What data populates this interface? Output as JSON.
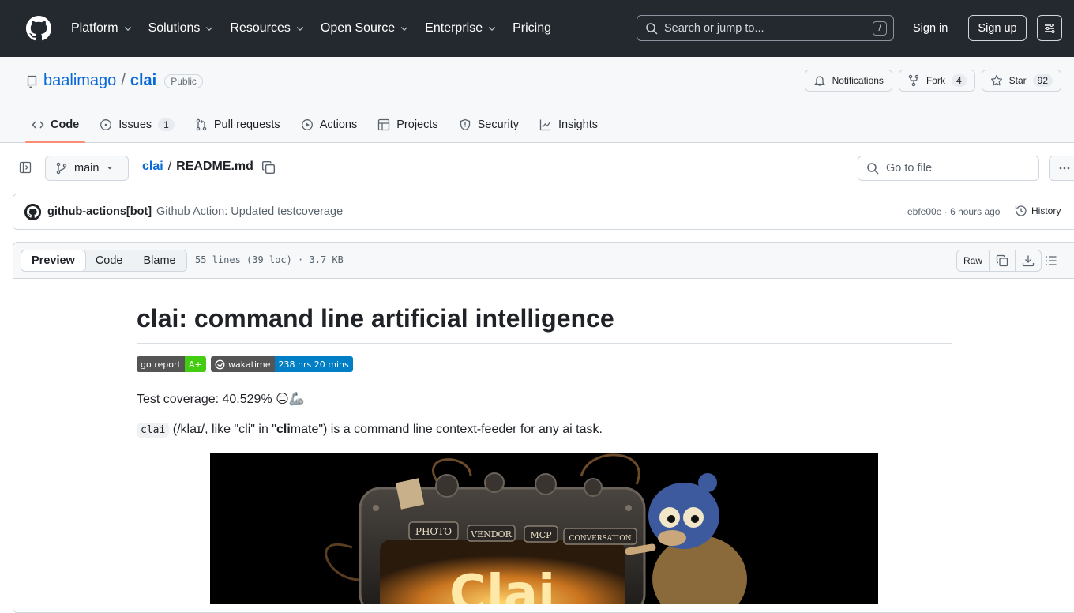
{
  "header": {
    "nav": [
      {
        "label": "Platform",
        "dropdown": true
      },
      {
        "label": "Solutions",
        "dropdown": true
      },
      {
        "label": "Resources",
        "dropdown": true
      },
      {
        "label": "Open Source",
        "dropdown": true
      },
      {
        "label": "Enterprise",
        "dropdown": true
      },
      {
        "label": "Pricing",
        "dropdown": false
      }
    ],
    "search_placeholder": "Search or jump to...",
    "search_shortcut": "/",
    "sign_in": "Sign in",
    "sign_up": "Sign up"
  },
  "repo": {
    "owner": "baalimago",
    "separator": "/",
    "name": "clai",
    "visibility": "Public",
    "notifications_label": "Notifications",
    "fork_label": "Fork",
    "fork_count": "4",
    "star_label": "Star",
    "star_count": "92"
  },
  "tabs": [
    {
      "label": "Code",
      "icon": "code-icon",
      "active": true
    },
    {
      "label": "Issues",
      "icon": "issue-opened-icon",
      "count": "1"
    },
    {
      "label": "Pull requests",
      "icon": "git-pull-request-icon"
    },
    {
      "label": "Actions",
      "icon": "play-icon"
    },
    {
      "label": "Projects",
      "icon": "table-icon"
    },
    {
      "label": "Security",
      "icon": "shield-icon"
    },
    {
      "label": "Insights",
      "icon": "graph-icon"
    }
  ],
  "file_nav": {
    "branch": "main",
    "repo_link": "clai",
    "separator": "/",
    "file_name": "README.md",
    "goto_placeholder": "Go to file"
  },
  "commit": {
    "author": "github-actions[bot]",
    "message": "Github Action: Updated testcoverage",
    "sha": "ebfe00e",
    "dot": "·",
    "time": "6 hours ago",
    "history_label": "History"
  },
  "file_toolbar": {
    "views": [
      {
        "label": "Preview",
        "active": true
      },
      {
        "label": "Code",
        "active": false
      },
      {
        "label": "Blame",
        "active": false
      }
    ],
    "info": "55 lines (39 loc) · 3.7 KB",
    "raw_label": "Raw"
  },
  "readme": {
    "title": "clai: command line artificial intelligence",
    "badges": {
      "go_report_label": "go report",
      "go_report_value": "A+",
      "go_report_color": "#44cc11",
      "wakatime_label": "wakatime",
      "wakatime_value": "238 hrs 20 mins",
      "wakatime_color": "#007ec6"
    },
    "coverage_text": "Test coverage: 40.529% 😑🦾",
    "desc_code": "clai",
    "desc_part1": " (/klaɪ/, like \"cli\" in \"",
    "desc_bold": "cli",
    "desc_part2": "mate\") is a command line context-feeder for any ai task.",
    "hero_labels": [
      "PHOTO",
      "VENDOR",
      "MCP",
      "CONVERSATION"
    ],
    "hero_logo_text": "Clai"
  },
  "colors": {
    "header_bg": "#24292f",
    "link": "#0969da",
    "active_tab_underline": "#fd8c73"
  }
}
